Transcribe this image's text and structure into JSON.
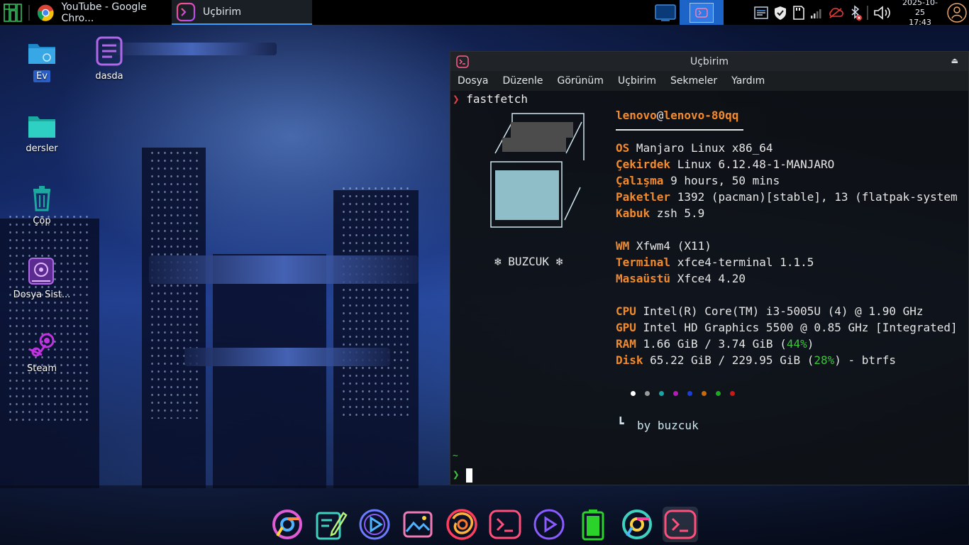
{
  "panel": {
    "tasks": [
      {
        "label": "YouTube - Google Chro...",
        "icon": "chrome-icon"
      },
      {
        "label": "Uçbirim",
        "icon": "terminal-icon"
      }
    ],
    "clock": {
      "date": "2025-10-25",
      "time": "17:43"
    }
  },
  "desktop": {
    "icons": [
      {
        "label": "Ev",
        "icon": "home-folder-icon"
      },
      {
        "label": "dasda",
        "icon": "text-file-icon"
      },
      {
        "label": "dersler",
        "icon": "folder-icon"
      },
      {
        "label": "Çöp",
        "icon": "trash-icon"
      },
      {
        "label": "Dosya Sist...",
        "icon": "filesystem-icon"
      },
      {
        "label": "Steam",
        "icon": "steam-icon"
      }
    ]
  },
  "terminal": {
    "title": "Uçbirim",
    "menu": [
      "Dosya",
      "Düzenle",
      "Görünüm",
      "Uçbirim",
      "Sekmeler",
      "Yardım"
    ],
    "command": "fastfetch",
    "logo_caption": "❄ BUZCUK ❄",
    "user": "lenovo",
    "at": "@",
    "host": "lenovo-80qq",
    "info": [
      {
        "key": "OS",
        "value": " Manjaro Linux x86_64"
      },
      {
        "key": "Çekirdek",
        "value": " Linux 6.12.48-1-MANJARO"
      },
      {
        "key": "Çalışma",
        "value": " 9 hours, 50 mins"
      },
      {
        "key": "Paketler",
        "value": " 1392 (pacman)[stable], 13 (flatpak-system"
      },
      {
        "key": "Kabuk",
        "value": " zsh 5.9"
      },
      {
        "key": "WM",
        "value": " Xfwm4 (X11)"
      },
      {
        "key": "Terminal",
        "value": " xfce4-terminal 1.1.5"
      },
      {
        "key": "Masaüstü",
        "value": " Xfce4 4.20"
      },
      {
        "key": "CPU",
        "value": " Intel(R) Core(TM) i3-5005U (4) @ 1.90 GHz"
      },
      {
        "key": "GPU",
        "value": " Intel HD Graphics 5500 @ 0.85 GHz [Integrated]"
      }
    ],
    "ram": {
      "key": "RAM",
      "pre": " 1.66 GiB / 3.74 GiB (",
      "pct": "44%",
      "post": ")"
    },
    "disk": {
      "key": "Disk",
      "pre": " 65.22 GiB / 229.95 GiB (",
      "pct": "28%",
      "post": ") - btrfs"
    },
    "palette": [
      "#ffffff",
      "#9a9a9a",
      "#1aa5a5",
      "#b11fb1",
      "#1b3fd6",
      "#c86a10",
      "#1fa62a",
      "#c81818"
    ],
    "byline": "by buzcuk",
    "tilde": "~",
    "prompt_symbol": "❯"
  },
  "dock": {
    "items": [
      "chrome-icon",
      "text-editor-icon",
      "media-player-icon",
      "image-viewer-icon",
      "firefox-icon",
      "terminal-icon",
      "media-player-icon",
      "battery-icon",
      "chrome-icon",
      "terminal-icon"
    ]
  }
}
